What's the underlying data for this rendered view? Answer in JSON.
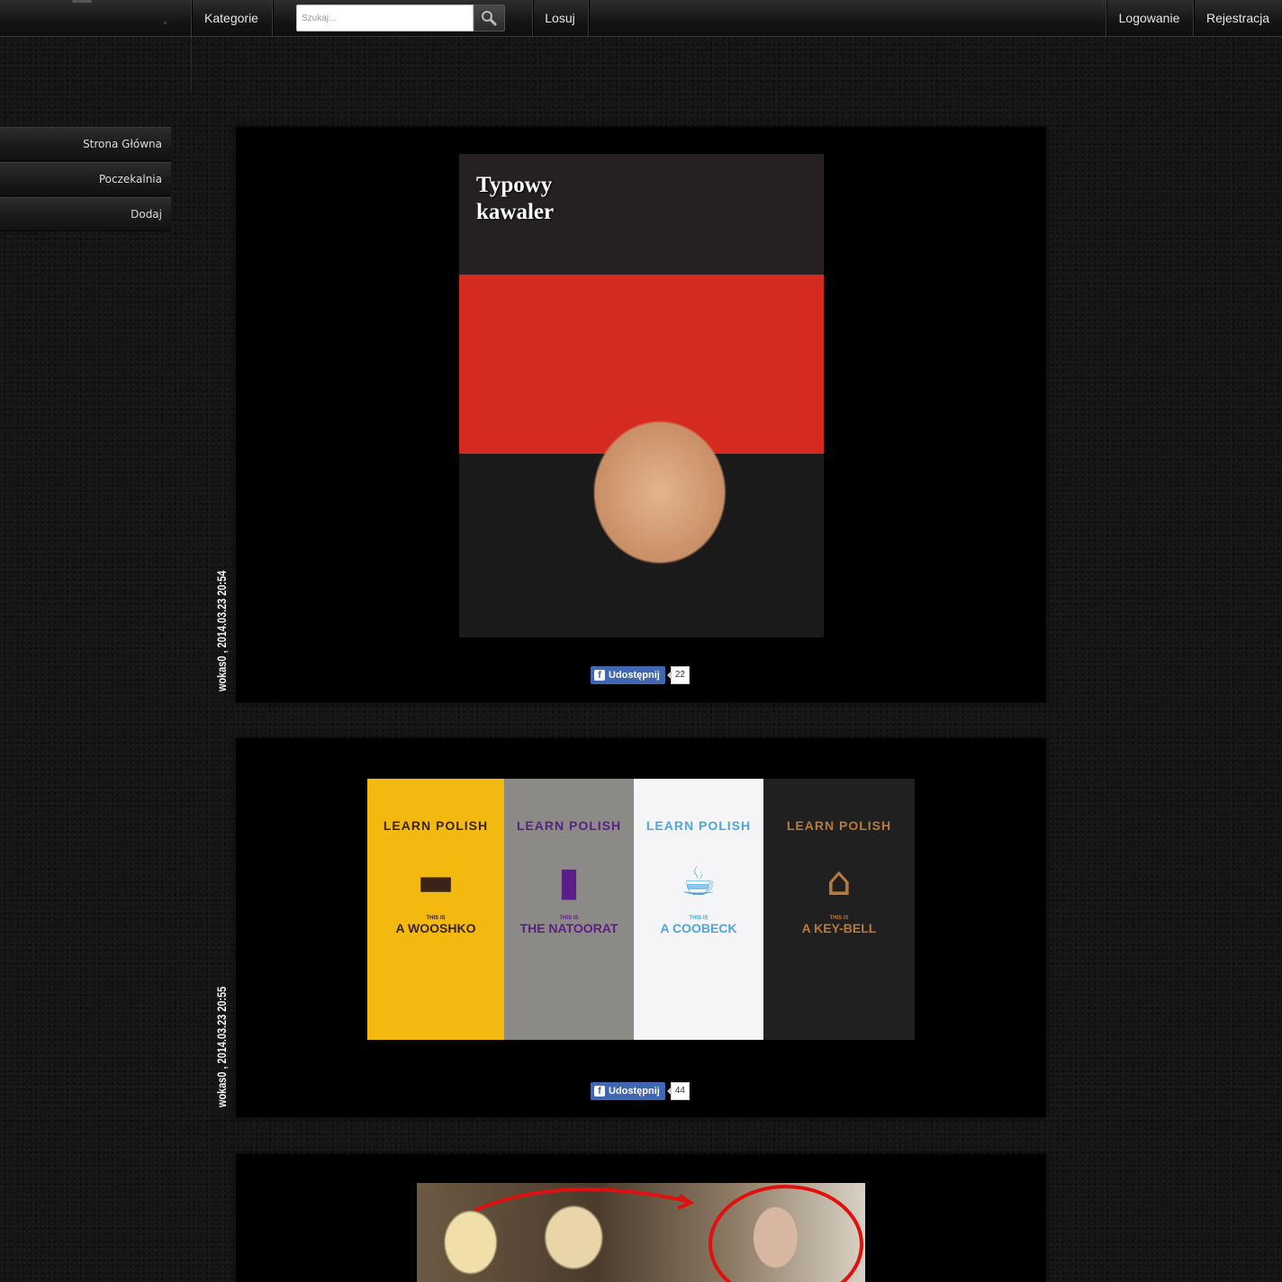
{
  "nav": {
    "categories_label": "Kategorie",
    "search_placeholder": "Szukaj...",
    "random_label": "Losuj",
    "login_label": "Logowanie",
    "register_label": "Rejestracja"
  },
  "sidebar": {
    "items": [
      {
        "label": "Strona Główna"
      },
      {
        "label": "Poczekalnia"
      },
      {
        "label": "Dodaj"
      }
    ]
  },
  "posts": [
    {
      "meta": "wokas0 , 2014.03.23 20:54",
      "image_caption": "Typowy\nkawaler",
      "share_label": "Udostępnij",
      "share_count": "22"
    },
    {
      "meta": "wokas0 , 2014.03.23 20:55",
      "share_label": "Udostępnij",
      "share_count": "44",
      "shirts": [
        {
          "header": "LEARN POLISH",
          "small": "THIS IS",
          "word": "A  WOOSHKO",
          "bg": "#f4b90f",
          "ink": "#3a2418",
          "icon": "bed-icon",
          "glyph": "🛏"
        },
        {
          "header": "LEARN POLISH",
          "small": "THIS IS",
          "word": "THE NATOORAT",
          "bg": "#8c8a86",
          "ink": "#5b1e86",
          "icon": "bottle-icon",
          "glyph": "🍾"
        },
        {
          "header": "LEARN POLISH",
          "small": "THIS IS",
          "word": "A COOBECK",
          "bg": "#f5f4f6",
          "ink": "#4aa8de",
          "icon": "mug-icon",
          "glyph": "☕"
        },
        {
          "header": "LEARN POLISH",
          "small": "THIS IS",
          "word": "A  KEY-BELL",
          "bg": "#202020",
          "ink": "#b87a3c",
          "icon": "outhouse-icon",
          "glyph": "🚪"
        }
      ]
    },
    {
      "meta": "",
      "share_label": "",
      "share_count": ""
    }
  ],
  "colors": {
    "facebook": "#4267b2",
    "page_bg": "#151515",
    "post_bg": "#000000"
  }
}
